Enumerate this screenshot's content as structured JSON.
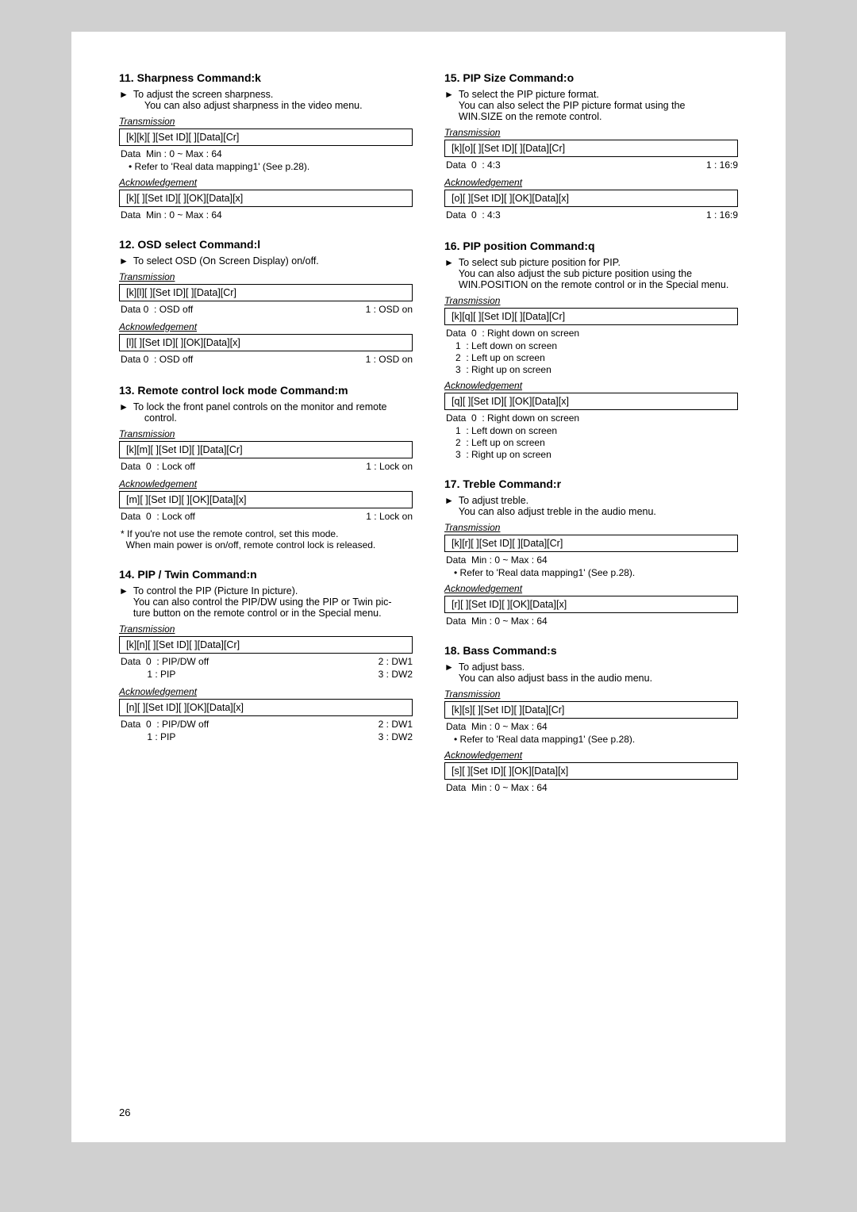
{
  "page": {
    "number": "26",
    "left_column": [
      {
        "id": "section-11",
        "title": "11. Sharpness Command:k",
        "bullets": [
          "To adjust the screen sharpness.",
          "You can also adjust sharpness in the video menu."
        ],
        "transmission_label": "Transmission",
        "transmission_code": "[k][k][  ][Set ID][  ][Data][Cr]",
        "transmission_data": [
          "Data  Min : 0 ~ Max : 64",
          "• Refer to 'Real data mapping1' (See p.28)."
        ],
        "acknowledgement_label": "Acknowledgement",
        "acknowledgement_code": "[k][  ][Set ID][  ][OK][Data][x]",
        "acknowledgement_data": [
          "Data  Min : 0 ~ Max : 64"
        ]
      },
      {
        "id": "section-12",
        "title": "12. OSD select Command:l",
        "bullets": [
          "To select OSD (On Screen Display) on/off."
        ],
        "transmission_label": "Transmission",
        "transmission_code": "[k][l][  ][Set ID][  ][Data][Cr]",
        "transmission_data": [
          "Data 0  : OSD off",
          "1 : OSD on"
        ],
        "acknowledgement_label": "Acknowledgement",
        "acknowledgement_code": "[l][  ][Set ID][  ][OK][Data][x]",
        "acknowledgement_data": [
          "Data 0  : OSD off",
          "1 : OSD on"
        ]
      },
      {
        "id": "section-13",
        "title": "13. Remote control lock mode Command:m",
        "bullets": [
          "To lock the front panel controls on the monitor and remote control."
        ],
        "transmission_label": "Transmission",
        "transmission_code": "[k][m][  ][Set ID][  ][Data][Cr]",
        "transmission_data": [
          "Data  0  : Lock off",
          "1 : Lock on"
        ],
        "acknowledgement_label": "Acknowledgement",
        "acknowledgement_code": "[m][  ][Set ID][  ][OK][Data][x]",
        "acknowledgement_data": [
          "Data  0  : Lock off",
          "1 : Lock on"
        ],
        "note": "* If you're not use the remote control, set this mode.\n  When main power is on/off, remote control lock is released."
      },
      {
        "id": "section-14",
        "title": "14. PIP / Twin Command:n",
        "bullets": [
          "To control the PIP (Picture In picture).",
          "You can also control the PIP/DW using the PIP or Twin picture button on the remote control or in the Special menu."
        ],
        "transmission_label": "Transmission",
        "transmission_code": "[k][n][  ][Set ID][  ][Data][Cr]",
        "transmission_data_multi": [
          {
            "col1": "Data  0  : PIP/DW off",
            "col2": "2 : DW1"
          },
          {
            "col1": "          1 : PIP",
            "col2": "3 : DW2"
          }
        ],
        "acknowledgement_label": "Acknowledgement",
        "acknowledgement_code": "[n][  ][Set ID][  ][OK][Data][x]",
        "acknowledgement_data_multi": [
          {
            "col1": "Data  0  : PIP/DW off",
            "col2": "2 : DW1"
          },
          {
            "col1": "          1 : PIP",
            "col2": "3 : DW2"
          }
        ]
      }
    ],
    "right_column": [
      {
        "id": "section-15",
        "title": "15. PIP Size Command:o",
        "bullets": [
          "To select the PIP picture format.",
          "You can also select the PIP picture format using the WIN.SIZE on the remote control."
        ],
        "transmission_label": "Transmission",
        "transmission_code": "[k][o][  ][Set ID][  ][Data][Cr]",
        "transmission_data": [
          "Data  0  :  4:3",
          "1  :  16:9"
        ],
        "acknowledgement_label": "Acknowledgement",
        "acknowledgement_code": "[o][  ][Set ID][  ][OK][Data][x]",
        "acknowledgement_data": [
          "Data  0  :  4:3",
          "1  :  16:9"
        ]
      },
      {
        "id": "section-16",
        "title": "16. PIP position Command:q",
        "bullets": [
          "To select sub picture position for PIP.",
          "You can also adjust the sub picture position using the WIN.POSITION on the remote control or in the Special menu."
        ],
        "transmission_label": "Transmission",
        "transmission_code": "[k][q][  ][Set ID][  ][Data][Cr]",
        "transmission_data": [
          "Data  0  : Right down on screen",
          "1  : Left down on screen",
          "2  : Left up on screen",
          "3  : Right up on screen"
        ],
        "acknowledgement_label": "Acknowledgement",
        "acknowledgement_code": "[q][  ][Set ID][  ][OK][Data][x]",
        "acknowledgement_data": [
          "Data  0  : Right down on screen",
          "1  : Left down on screen",
          "2  : Left up on screen",
          "3  : Right up on screen"
        ]
      },
      {
        "id": "section-17",
        "title": "17. Treble Command:r",
        "bullets": [
          "To adjust treble.",
          "You can also adjust treble in the audio menu."
        ],
        "transmission_label": "Transmission",
        "transmission_code": "[k][r][  ][Set ID][  ][Data][Cr]",
        "transmission_data": [
          "Data  Min : 0 ~ Max : 64",
          "• Refer to 'Real data mapping1' (See p.28)."
        ],
        "acknowledgement_label": "Acknowledgement",
        "acknowledgement_code": "[r][  ][Set ID][  ][OK][Data][x]",
        "acknowledgement_data": [
          "Data  Min : 0 ~ Max : 64"
        ]
      },
      {
        "id": "section-18",
        "title": "18. Bass Command:s",
        "bullets": [
          "To adjust bass.",
          "You can also adjust bass in the audio menu."
        ],
        "transmission_label": "Transmission",
        "transmission_code": "[k][s][  ][Set ID][  ][Data][Cr]",
        "transmission_data": [
          "Data  Min : 0 ~ Max : 64",
          "• Refer to 'Real data mapping1' (See p.28)."
        ],
        "acknowledgement_label": "Acknowledgement",
        "acknowledgement_code": "[s][  ][Set ID][  ][OK][Data][x]",
        "acknowledgement_data": [
          "Data  Min : 0 ~ Max : 64"
        ]
      }
    ]
  }
}
